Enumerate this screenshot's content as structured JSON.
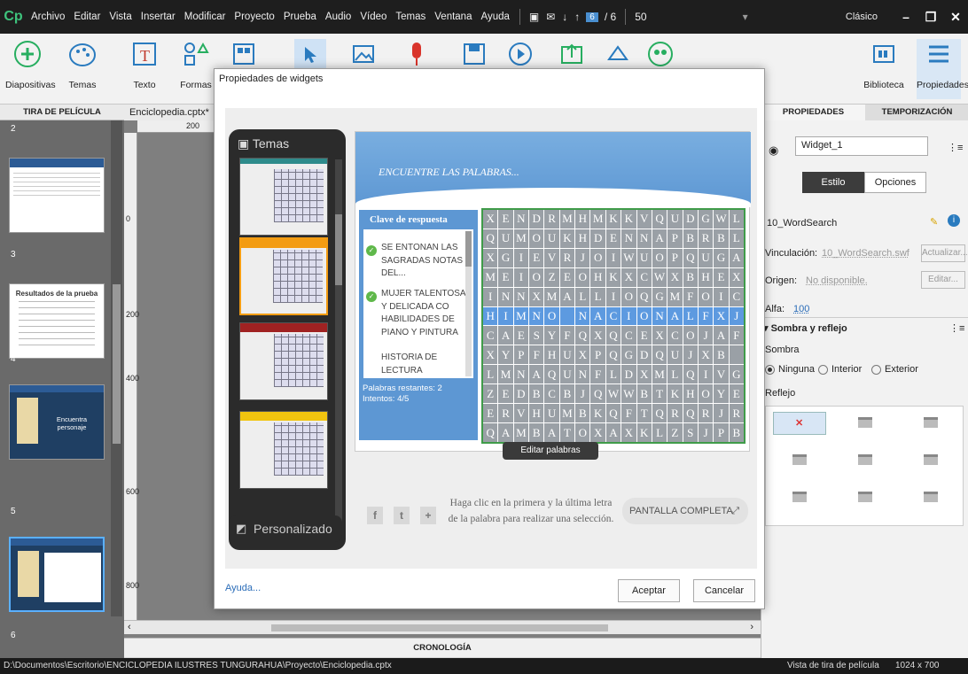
{
  "menubar": {
    "logo": "Cp",
    "items": [
      "Archivo",
      "Editar",
      "Vista",
      "Insertar",
      "Modificar",
      "Proyecto",
      "Prueba",
      "Audio",
      "Vídeo",
      "Temas",
      "Ventana",
      "Ayuda"
    ],
    "slide_current": "6",
    "slide_total": "/ 6",
    "zoom": "50",
    "workspace": "Clásico"
  },
  "toolbar": {
    "diapositivas": "Diapositivas",
    "temas": "Temas",
    "texto": "Texto",
    "formas": "Formas",
    "biblioteca": "Biblioteca",
    "propiedades": "Propiedades"
  },
  "filmstrip": {
    "header": "TIRA DE PELÍCULA",
    "slides": [
      "2",
      "3",
      "4",
      "5",
      "6"
    ],
    "thumb3_title": "Resultados de la prueba",
    "thumb4_title": "Encuentra personaje"
  },
  "editor": {
    "doc_tab": "Enciclopedia.cptx*",
    "ruler_h": [
      "200"
    ],
    "ruler_v": [
      "0",
      "200",
      "400",
      "600",
      "800"
    ],
    "timeline": "CRONOLOGÍA"
  },
  "rightpanel": {
    "tab_props": "PROPIEDADES",
    "tab_timing": "TEMPORIZACIÓN",
    "widget_name": "Widget_1",
    "style_tab": "Estilo",
    "options_tab": "Opciones",
    "widget_id": "10_WordSearch",
    "binding_label": "Vinculación:",
    "binding_value": "10_WordSearch.swf",
    "update_btn": "Actualizar...",
    "origin_label": "Origen:",
    "origin_value": "No disponible.",
    "edit_btn": "Editar...",
    "alpha_label": "Alfa:",
    "alpha_value": "100",
    "shadow_section": "Sombra y reflejo",
    "shadow_label": "Sombra",
    "shadow_none": "Ninguna",
    "shadow_inner": "Interior",
    "shadow_outer": "Exterior",
    "reflection_label": "Reflejo"
  },
  "statusbar": {
    "path": "D:\\Documentos\\Escritorio\\ENCICLOPEDIA ILUSTRES TUNGURAHUA\\Proyecto\\Enciclopedia.cptx",
    "view": "Vista de tira de película",
    "size": "1024 x 700"
  },
  "dialog": {
    "title": "Propiedades de widgets",
    "themes_label": "Temas",
    "custom_label": "Personalizado",
    "game_title": "ENCUENTRE LAS PALABRAS...",
    "answer_key": "Clave de respuesta",
    "clues": [
      "SE ENTONAN LAS SAGRADAS NOTAS DEL...",
      "MUJER TALENTOSA Y DELICADA CO HABILIDADES DE PIANO Y PINTURA",
      "HISTORIA DE LECTURA"
    ],
    "remaining": "Palabras restantes: 2",
    "attempts": "Intentos: 4/5",
    "grid": [
      "XENDRMHMKKVQUDGWL",
      "QUMOUKHDENNAPBRBL",
      "XGIEVRJOIWUOPQUGA",
      "MEIOZEOHKXCWXBHEX",
      "INNXMALLIOQGMFOIC",
      "HIMNO NACIONALFXJ",
      "CAESYFQXQCEXCOJAF",
      "XYPFHUXPQGDQUJXB",
      "LMNAQUNFLDXMLQIVG",
      "ZEDBCBJQWWBTKHOYE",
      "ERVHUMBKQFTQRQRJR",
      "QAMBATOXAXKLZSJPB"
    ],
    "edit_words": "Editar palabras",
    "hint": "Haga clic en la primera y la última letra de la palabra para realizar una selección.",
    "fullscreen": "PANTALLA COMPLETA",
    "help": "Ayuda...",
    "ok": "Aceptar",
    "cancel": "Cancelar"
  },
  "colors": {
    "accent": "#5d97d3",
    "board": "#3f9b49",
    "cell": "#9aa0a6",
    "highlight": "#5d9ae0"
  }
}
